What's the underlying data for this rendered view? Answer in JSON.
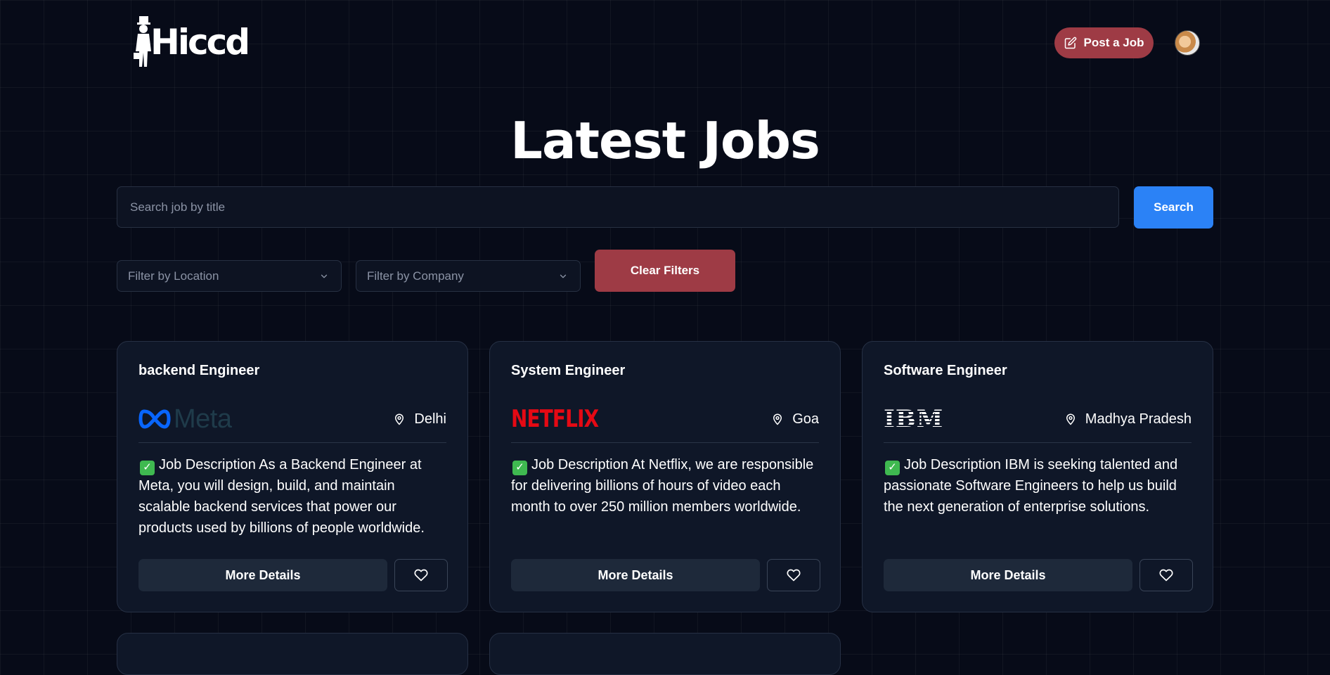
{
  "header": {
    "logo_text": "Hiccd",
    "post_job_label": "Post a Job"
  },
  "page": {
    "title": "Latest Jobs"
  },
  "search": {
    "placeholder": "Search job by title",
    "button_label": "Search"
  },
  "filters": {
    "location_placeholder": "Filter by Location",
    "company_placeholder": "Filter by Company",
    "clear_label": "Clear Filters"
  },
  "jobs": [
    {
      "title": "backend Engineer",
      "company_logo_text": "Meta",
      "company_logo_icon": "meta-infinity-icon",
      "location": "Delhi",
      "description": "Job Description As a Backend Engineer at Meta, you will design, build, and maintain scalable backend services that power our products used by billions of people worldwide.",
      "details_label": "More Details"
    },
    {
      "title": "System Engineer",
      "company_logo_text": "NETFLIX",
      "location": "Goa",
      "description": "Job Description At Netflix, we are responsible for delivering billions of hours of video each month to over 250 million members worldwide.",
      "details_label": "More Details"
    },
    {
      "title": "Software Engineer",
      "company_logo_text": "IBM",
      "location": "Madhya Pradesh",
      "description": "Job Description IBM is seeking talented and passionate Software Engineers to help us build the next generation of enterprise solutions.",
      "details_label": "More Details"
    }
  ],
  "colors": {
    "background": "#070b18",
    "accent_red": "#9e3b45",
    "accent_blue": "#2b82f6",
    "card": "#0f1728",
    "netflix_red": "#e50914",
    "meta_blue": "#0866ff"
  },
  "icons": {
    "post_job": "edit-icon",
    "location": "map-pin-icon",
    "favorite": "heart-icon",
    "dropdown": "chevron-down-icon",
    "check": "check-box-icon"
  }
}
